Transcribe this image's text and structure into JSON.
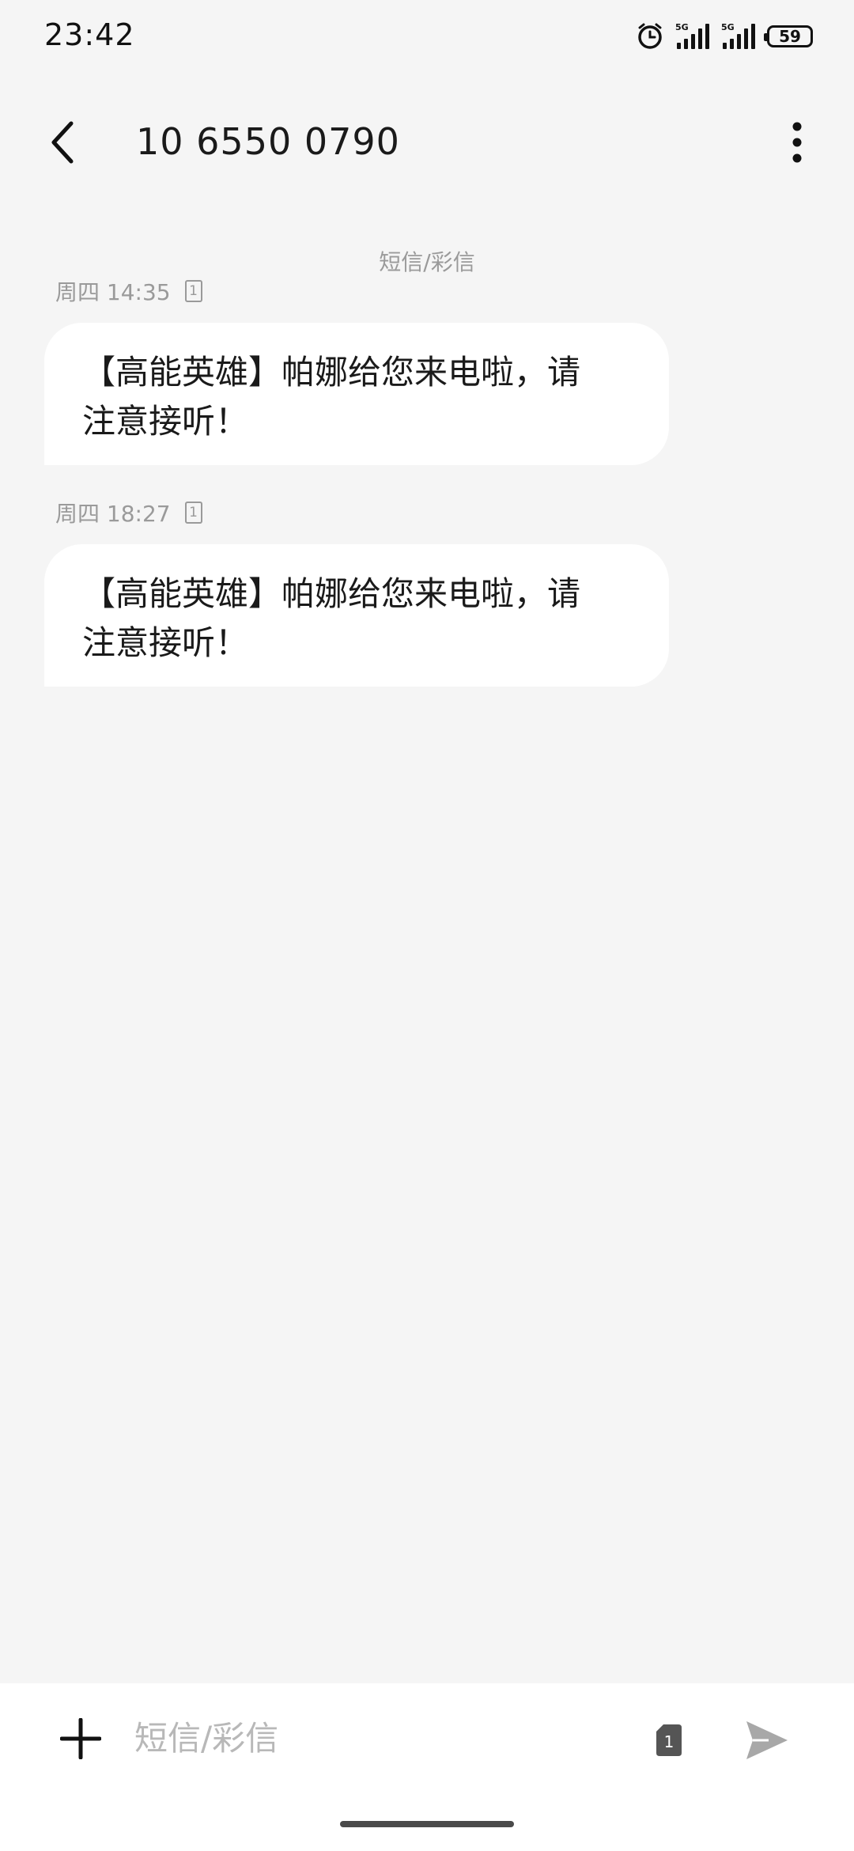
{
  "status_bar": {
    "time": "23:42",
    "network_1": "5G",
    "network_2": "5G",
    "battery_level": "59",
    "icons": [
      "alarm-clock-icon",
      "signal-5g-icon",
      "signal-5g-icon",
      "battery-icon"
    ]
  },
  "header": {
    "contact": "10 6550 0790",
    "back_icon": "chevron-left-icon",
    "more_icon": "more-vertical-icon"
  },
  "conversation": {
    "channel_label": "短信/彩信",
    "messages": [
      {
        "time": "周四 14:35",
        "sim": "1",
        "line1": "【高能英雄】帕娜给您来电啦，请",
        "line2": "注意接听！"
      },
      {
        "time": "周四 18:27",
        "sim": "1",
        "line1": "【高能英雄】帕娜给您来电啦，请",
        "line2": "注意接听！"
      }
    ]
  },
  "composer": {
    "placeholder": "短信/彩信",
    "sim": "1",
    "add_icon": "plus-icon",
    "send_icon": "send-icon"
  }
}
